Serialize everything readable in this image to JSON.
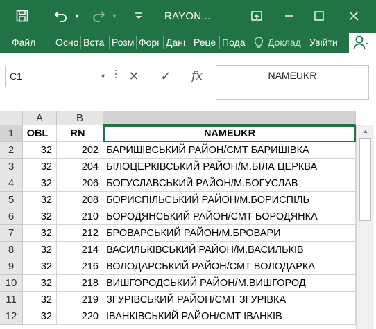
{
  "window": {
    "title": "RAYON...",
    "colors": {
      "excel_green": "#217346"
    }
  },
  "qat": {
    "save_icon": "save-icon",
    "undo_icon": "undo-icon",
    "redo_icon": "redo-icon",
    "customize_icon": "customize-qat-icon"
  },
  "ribbon": {
    "tabs": [
      "Файл",
      "Осно",
      "Вста",
      "Розм",
      "Форі",
      "Дані",
      "Реце",
      "Пода"
    ],
    "tell_me": "Доклад",
    "sign_in": "Увійти"
  },
  "formula_bar": {
    "name_box": "C1",
    "content": "NAMEUKR"
  },
  "grid": {
    "columns": [
      "A",
      "B",
      ""
    ],
    "rows": [
      {
        "n": "1",
        "a": "OBL",
        "b": "RN",
        "c": "NAMEUKR"
      },
      {
        "n": "2",
        "a": "32",
        "b": "202",
        "c": "БАРИШІВСЬКИЙ РАЙОН/СМТ БАРИШІВКА"
      },
      {
        "n": "3",
        "a": "32",
        "b": "204",
        "c": "БІЛОЦЕРКІВСЬКИЙ РАЙОН/М.БІЛА ЦЕРКВА"
      },
      {
        "n": "4",
        "a": "32",
        "b": "206",
        "c": "БОГУСЛАВСЬКИЙ РАЙОН/М.БОГУСЛАВ"
      },
      {
        "n": "5",
        "a": "32",
        "b": "208",
        "c": "БОРИСПІЛЬСЬКИЙ РАЙОН/М.БОРИСПІЛЬ"
      },
      {
        "n": "6",
        "a": "32",
        "b": "210",
        "c": "БОРОДЯНСЬКИЙ РАЙОН/СМТ БОРОДЯНКА"
      },
      {
        "n": "7",
        "a": "32",
        "b": "212",
        "c": "БРОВАРСЬКИЙ РАЙОН/М.БРОВАРИ"
      },
      {
        "n": "8",
        "a": "32",
        "b": "214",
        "c": "ВАСИЛЬКІВСЬКИЙ РАЙОН/М.ВАСИЛЬКІВ"
      },
      {
        "n": "9",
        "a": "32",
        "b": "216",
        "c": "ВОЛОДАРСЬКИЙ РАЙОН/СМТ ВОЛОДАРКА"
      },
      {
        "n": "10",
        "a": "32",
        "b": "218",
        "c": "ВИШГОРОДСЬКИЙ РАЙОН/М.ВИШГОРОД"
      },
      {
        "n": "11",
        "a": "32",
        "b": "219",
        "c": "ЗГУРІВСЬКИЙ РАЙОН/СМТ ЗГУРІВКА"
      },
      {
        "n": "12",
        "a": "32",
        "b": "220",
        "c": "ІВАНКІВСЬКИЙ РАЙОН/СМТ ІВАНКІВ"
      }
    ]
  }
}
